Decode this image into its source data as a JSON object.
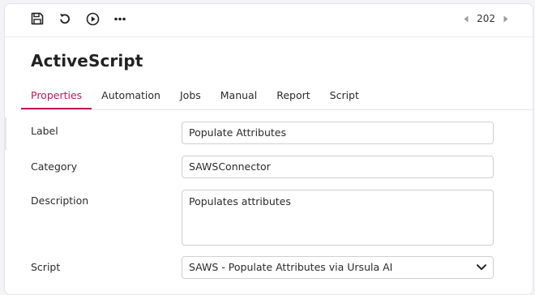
{
  "toolbar": {
    "icons": [
      "save-icon",
      "undo-icon",
      "play-icon",
      "more-icon"
    ],
    "page_number": "202"
  },
  "header": {
    "title": "ActiveScript"
  },
  "tabs": [
    {
      "label": "Properties",
      "active": true
    },
    {
      "label": "Automation",
      "active": false
    },
    {
      "label": "Jobs",
      "active": false
    },
    {
      "label": "Manual",
      "active": false
    },
    {
      "label": "Report",
      "active": false
    },
    {
      "label": "Script",
      "active": false
    }
  ],
  "form": {
    "label": {
      "label": "Label",
      "value": "Populate Attributes"
    },
    "category": {
      "label": "Category",
      "value": "SAWSConnector"
    },
    "description": {
      "label": "Description",
      "value": "Populates attributes"
    },
    "script": {
      "label": "Script",
      "value": "SAWS - Populate Attributes via Ursula AI"
    }
  },
  "colors": {
    "accent": "#c2185b",
    "border": "#cfcfd4",
    "text": "#2b2b2b"
  }
}
